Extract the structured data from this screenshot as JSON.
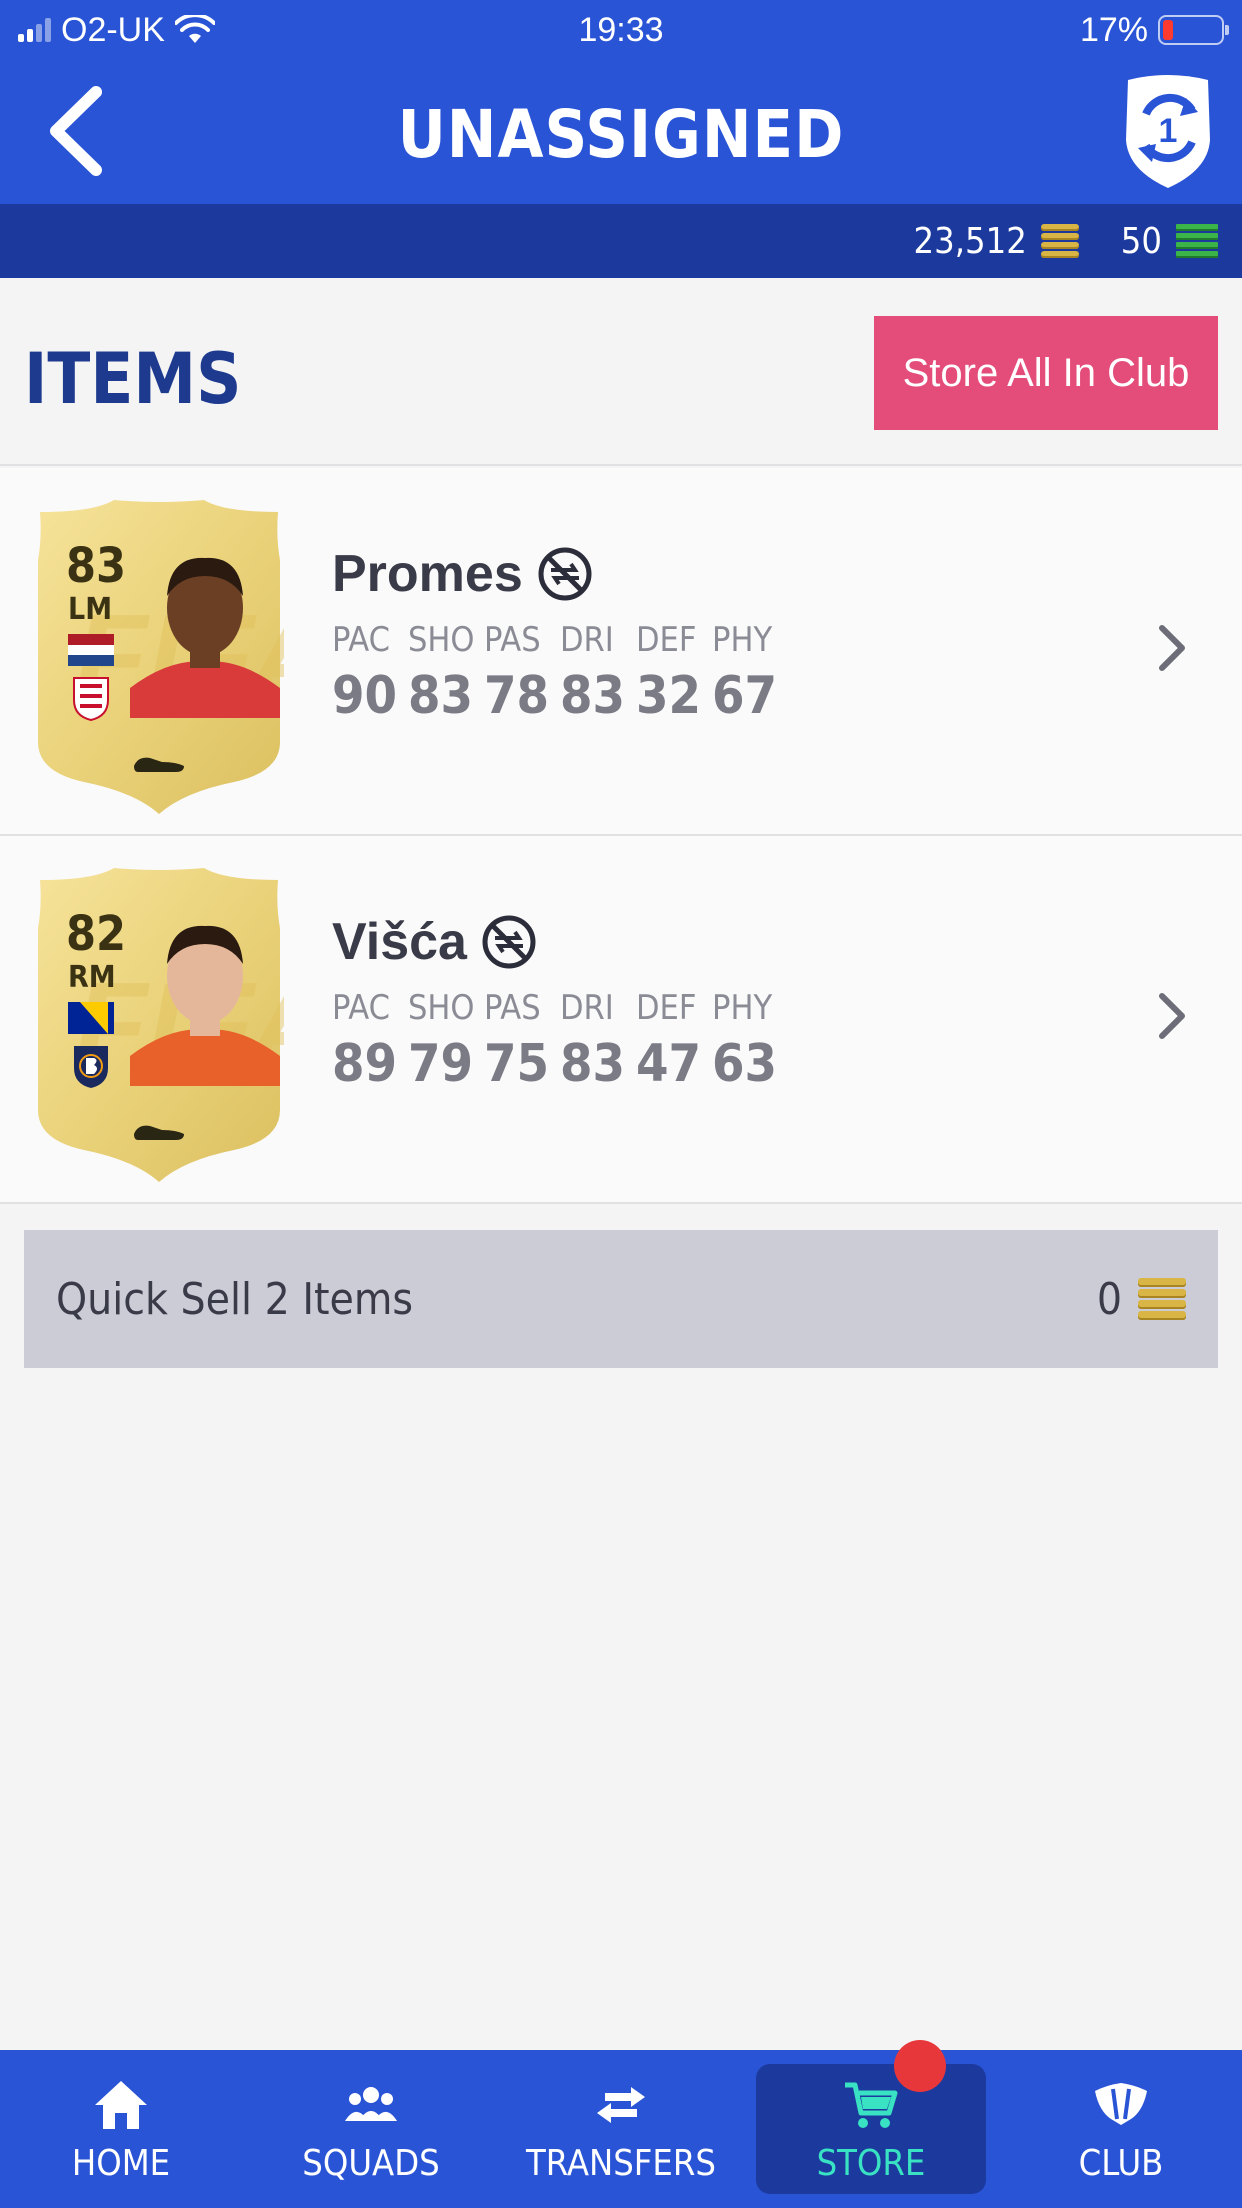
{
  "status_bar": {
    "carrier": "O2-UK",
    "time": "19:33",
    "battery": "17%"
  },
  "header": {
    "title": "UNASSIGNED",
    "badge_number": "1"
  },
  "currency": {
    "coins": "23,512",
    "points": "50"
  },
  "items_section": {
    "title": "ITEMS",
    "store_all_label": "Store All In Club"
  },
  "stat_labels": [
    "PAC",
    "SHO",
    "PAS",
    "DRI",
    "DEF",
    "PHY"
  ],
  "players": [
    {
      "name": "Promes",
      "rating": "83",
      "position": "LM",
      "stats": [
        "90",
        "83",
        "78",
        "83",
        "32",
        "67"
      ],
      "skin": "#6b3f24",
      "shirt": "#d93a3a"
    },
    {
      "name": "Višća",
      "rating": "82",
      "position": "RM",
      "stats": [
        "89",
        "79",
        "75",
        "83",
        "47",
        "63"
      ],
      "skin": "#e5b79a",
      "shirt": "#e8602a"
    }
  ],
  "quick_sell": {
    "label": "Quick Sell 2 Items",
    "value": "0"
  },
  "tabs": [
    {
      "label": "HOME",
      "icon": "home-icon"
    },
    {
      "label": "SQUADS",
      "icon": "squads-icon"
    },
    {
      "label": "TRANSFERS",
      "icon": "transfers-icon"
    },
    {
      "label": "STORE",
      "icon": "store-cart-icon",
      "active": true
    },
    {
      "label": "CLUB",
      "icon": "club-icon"
    }
  ],
  "colors": {
    "primary": "#2a54d6",
    "dark_primary": "#1c3a9e",
    "accent_pink": "#e44c7a",
    "active_tab": "#38e2c2"
  }
}
